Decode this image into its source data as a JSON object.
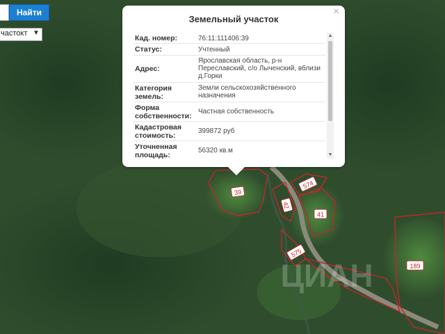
{
  "search": {
    "button_label": "Найти"
  },
  "layer_select": {
    "value": "частокт"
  },
  "popup": {
    "title": "Земельный участок",
    "close_glyph": "×",
    "rows": [
      {
        "label": "Кад. номер:",
        "value": "76:11:111406:39"
      },
      {
        "label": "Статус:",
        "value": "Учтенный"
      },
      {
        "label": "Адрес:",
        "value": "Ярославская область, р-н Переславский, с/о Лыченский, вблизи д.Горки"
      },
      {
        "label": "Категория земель:",
        "value": "Земли сельскохозяйственного назначения"
      },
      {
        "label": "Форма собственности:",
        "value": "Частная собственность"
      },
      {
        "label": "Кадастровая стоимость:",
        "value": "399872 руб"
      },
      {
        "label": "Уточненная площадь:",
        "value": "56320 кв.м"
      }
    ]
  },
  "parcels": [
    {
      "label": "39"
    },
    {
      "label": "574"
    },
    {
      "label": "42"
    },
    {
      "label": "41"
    },
    {
      "label": "575"
    },
    {
      "label": "189"
    }
  ],
  "watermark": {
    "text": "ЦИАН"
  },
  "colors": {
    "parcel_border": "#c0282c",
    "button": "#1b80d2",
    "road": "#8c8a7c"
  }
}
